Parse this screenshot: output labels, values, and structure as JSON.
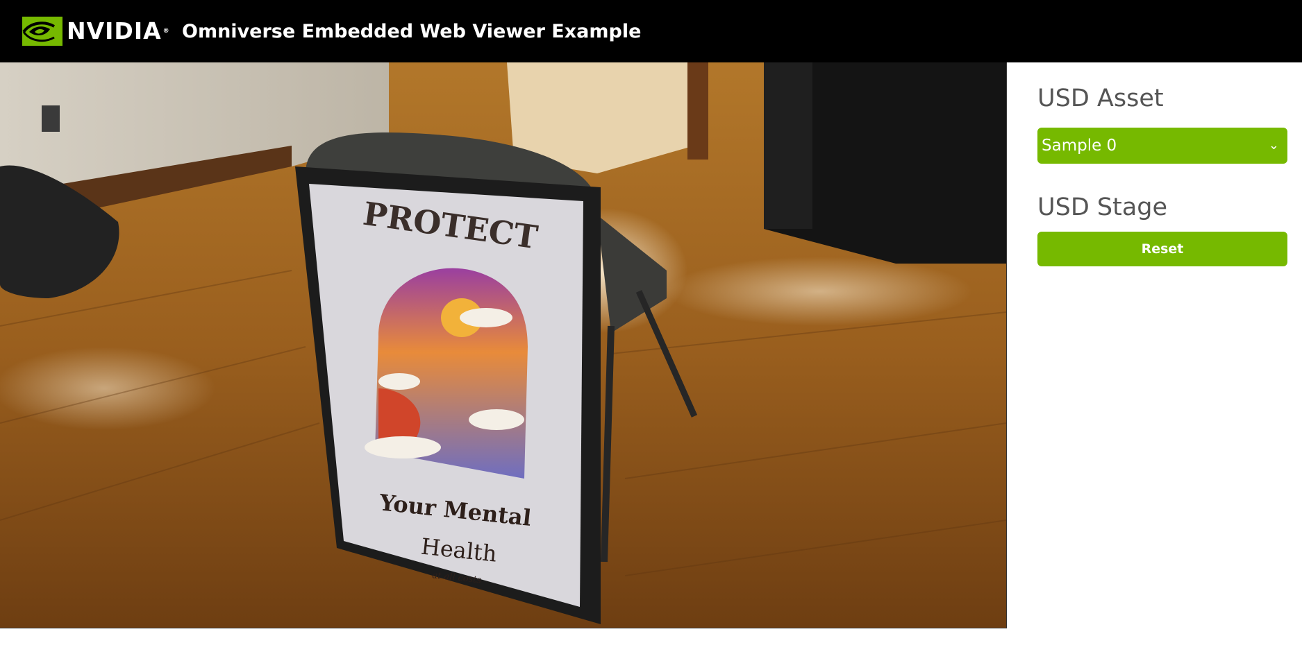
{
  "header": {
    "brand": "NVIDIA",
    "reg_mark": "®",
    "title": "Omniverse Embedded Web Viewer Example"
  },
  "viewport": {
    "poster": {
      "line1": "PROTECT",
      "line2": "Your Mental",
      "line3": "Health",
      "line4": "at all costs"
    }
  },
  "panel": {
    "asset_title": "USD Asset",
    "asset_select_value": "Sample 0",
    "stage_title": "USD Stage",
    "reset_label": "Reset"
  },
  "colors": {
    "accent": "#76b900",
    "header_bg": "#000000",
    "title_text": "#555555"
  },
  "icons": {
    "logo": "nvidia-eye-icon",
    "dropdown": "chevron-down-icon"
  }
}
